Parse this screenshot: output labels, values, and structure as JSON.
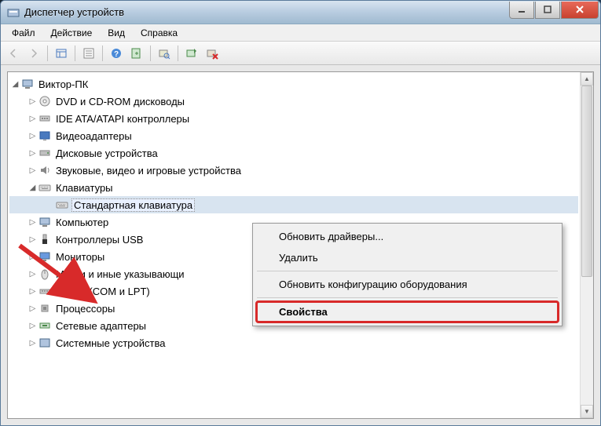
{
  "window": {
    "title": "Диспетчер устройств"
  },
  "menu": {
    "file": "Файл",
    "action": "Действие",
    "view": "Вид",
    "help": "Справка"
  },
  "tree": {
    "root": "Виктор-ПК",
    "items": [
      "DVD и CD-ROM дисководы",
      "IDE ATA/ATAPI контроллеры",
      "Видеоадаптеры",
      "Дисковые устройства",
      "Звуковые, видео и игровые устройства",
      "Клавиатуры",
      "Компьютер",
      "Контроллеры USB",
      "Мониторы",
      "Мыши и иные указывающи",
      "Порты (COM и LPT)",
      "Процессоры",
      "Сетевые адаптеры",
      "Системные устройства"
    ],
    "keyboard_child": "Стандартная клавиатура"
  },
  "context_menu": {
    "update": "Обновить драйверы...",
    "delete": "Удалить",
    "scan": "Обновить конфигурацию оборудования",
    "properties": "Свойства"
  }
}
